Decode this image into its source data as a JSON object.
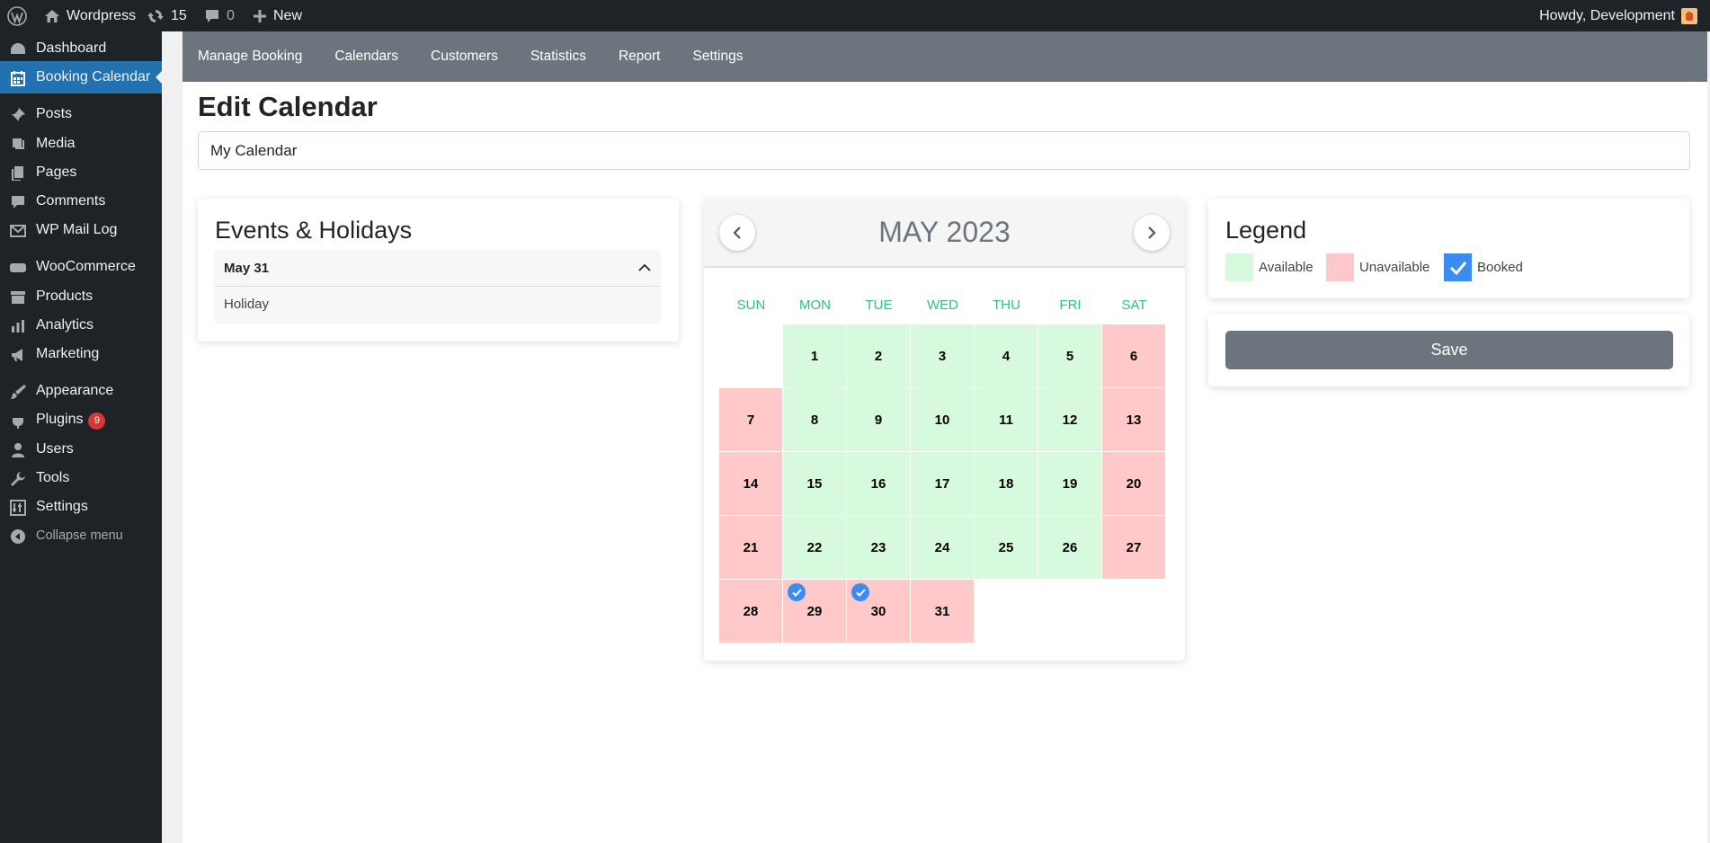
{
  "adminbar": {
    "site_name": "Wordpress",
    "updates_count": "15",
    "comments_count": "0",
    "new_label": "New",
    "greeting": "Howdy, Development"
  },
  "sidebar": {
    "items": [
      {
        "label": "Dashboard",
        "icon": "dashboard-icon"
      },
      {
        "label": "Booking Calendar",
        "icon": "calendar-icon",
        "active": true
      },
      {
        "label": "Posts",
        "icon": "pin-icon"
      },
      {
        "label": "Media",
        "icon": "media-icon"
      },
      {
        "label": "Pages",
        "icon": "pages-icon"
      },
      {
        "label": "Comments",
        "icon": "comment-icon"
      },
      {
        "label": "WP Mail Log",
        "icon": "mail-icon"
      },
      {
        "label": "WooCommerce",
        "icon": "woo-icon"
      },
      {
        "label": "Products",
        "icon": "archive-icon"
      },
      {
        "label": "Analytics",
        "icon": "bar-chart-icon"
      },
      {
        "label": "Marketing",
        "icon": "megaphone-icon"
      },
      {
        "label": "Appearance",
        "icon": "brush-icon"
      },
      {
        "label": "Plugins",
        "icon": "plugin-icon",
        "badge": "9"
      },
      {
        "label": "Users",
        "icon": "user-icon"
      },
      {
        "label": "Tools",
        "icon": "wrench-icon"
      },
      {
        "label": "Settings",
        "icon": "sliders-icon"
      },
      {
        "label": "Collapse menu",
        "icon": "collapse-icon"
      }
    ]
  },
  "topnav": {
    "links": [
      "Manage Booking",
      "Calendars",
      "Customers",
      "Statistics",
      "Report",
      "Settings"
    ]
  },
  "page": {
    "title": "Edit Calendar",
    "calendar_name": "My Calendar"
  },
  "events": {
    "title": "Events & Holidays",
    "items": [
      {
        "date": "May 31",
        "name": "Holiday"
      }
    ]
  },
  "calendar": {
    "title": "MAY 2023",
    "weekdays": [
      "SUN",
      "MON",
      "TUE",
      "WED",
      "THU",
      "FRI",
      "SAT"
    ],
    "days": [
      {
        "d": "1",
        "s": "available"
      },
      {
        "d": "2",
        "s": "available"
      },
      {
        "d": "3",
        "s": "available"
      },
      {
        "d": "4",
        "s": "available"
      },
      {
        "d": "5",
        "s": "available"
      },
      {
        "d": "6",
        "s": "unavailable"
      },
      {
        "d": "7",
        "s": "unavailable"
      },
      {
        "d": "8",
        "s": "available"
      },
      {
        "d": "9",
        "s": "available"
      },
      {
        "d": "10",
        "s": "available"
      },
      {
        "d": "11",
        "s": "available"
      },
      {
        "d": "12",
        "s": "available"
      },
      {
        "d": "13",
        "s": "unavailable"
      },
      {
        "d": "14",
        "s": "unavailable"
      },
      {
        "d": "15",
        "s": "available"
      },
      {
        "d": "16",
        "s": "available"
      },
      {
        "d": "17",
        "s": "available"
      },
      {
        "d": "18",
        "s": "available"
      },
      {
        "d": "19",
        "s": "available"
      },
      {
        "d": "20",
        "s": "unavailable"
      },
      {
        "d": "21",
        "s": "unavailable"
      },
      {
        "d": "22",
        "s": "available"
      },
      {
        "d": "23",
        "s": "available"
      },
      {
        "d": "24",
        "s": "available"
      },
      {
        "d": "25",
        "s": "available"
      },
      {
        "d": "26",
        "s": "available"
      },
      {
        "d": "27",
        "s": "unavailable"
      },
      {
        "d": "28",
        "s": "unavailable"
      },
      {
        "d": "29",
        "s": "unavailable",
        "booked": true
      },
      {
        "d": "30",
        "s": "unavailable",
        "booked": true
      },
      {
        "d": "31",
        "s": "unavailable"
      }
    ],
    "first_weekday": 1
  },
  "legend": {
    "title": "Legend",
    "available_label": "Available",
    "unavailable_label": "Unavailable",
    "booked_label": "Booked"
  },
  "actions": {
    "save_label": "Save"
  },
  "colors": {
    "available": "#d7f9de",
    "unavailable": "#ffc9c9",
    "booked": "#3b8cf0",
    "accent": "#2271b1",
    "nav_bg": "#6c757d"
  }
}
